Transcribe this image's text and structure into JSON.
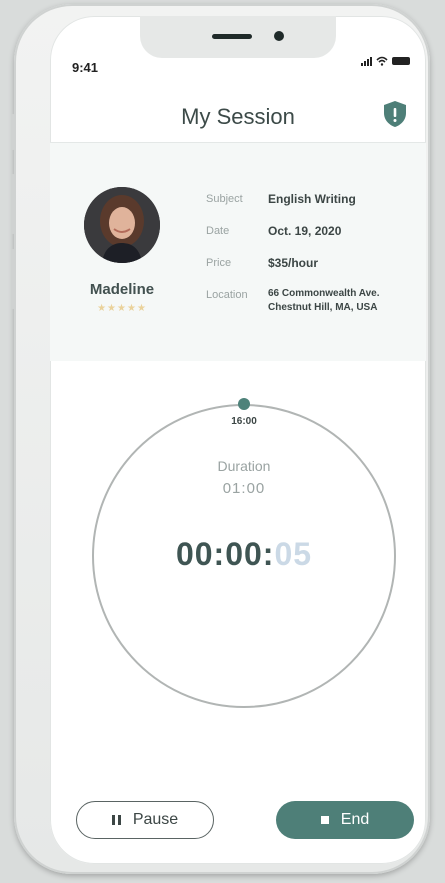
{
  "status_bar": {
    "time": "9:41"
  },
  "header": {
    "title": "My Session"
  },
  "profile": {
    "name": "Madeline",
    "rating": "★★★★★"
  },
  "session_info": {
    "subject_label": "Subject",
    "subject_value": "English Writing",
    "date_label": "Date",
    "date_value": "Oct. 19, 2020",
    "price_label": "Price",
    "price_value": "$35/hour",
    "location_label": "Location",
    "location_line1": "66 Commonwealth Ave.",
    "location_line2": "Chestnut Hill, MA, USA"
  },
  "timer": {
    "knob_label": "16:00",
    "duration_label": "Duration",
    "duration_value": "01:00",
    "elapsed_main": "00:00:",
    "elapsed_seconds": "05"
  },
  "actions": {
    "pause_label": "Pause",
    "end_label": "End"
  },
  "colors": {
    "accent": "#4e7f78",
    "text_dark": "#3c4645",
    "muted": "#9aa3a2"
  }
}
